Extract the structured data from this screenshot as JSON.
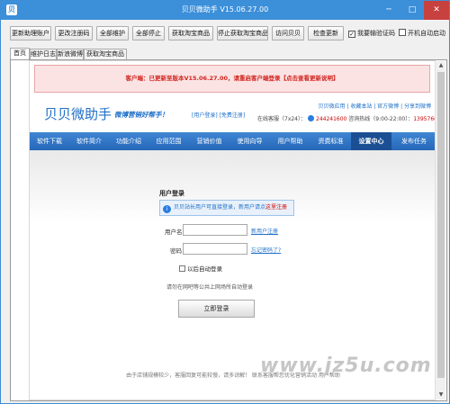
{
  "window": {
    "title": "贝贝微助手 V15.06.27.00",
    "minimize": "─",
    "maximize": "□",
    "close": "✕"
  },
  "toolbar": {
    "buttons": [
      "更新助理账户",
      "更改注册码",
      "全部维护",
      "全部停止",
      "获取淘宝商品",
      "停止获取淘宝商品",
      "访问贝贝",
      "检查更新"
    ],
    "checkboxes": [
      {
        "label": "我要输验证码",
        "checked": true
      },
      {
        "label": "开机自动启动",
        "checked": false
      }
    ]
  },
  "tabs": [
    "首页",
    "维护日志",
    "新浪微博",
    "获取淘宝商品"
  ],
  "notice": "客户端：已更新至版本V15.06.27.00，请重启客户端登录【点击查看更新说明】",
  "site": {
    "logo": "贝贝微助手",
    "slogan": "微博营销好帮手！",
    "header_links": "[用户登录] [免费注册]",
    "top_links": "贝贝微应用 | 收藏本站 | 官方微博 | 分享到微博",
    "online_label": "在线客服（7x24）：",
    "qq": "244241600",
    "hours_label": "咨询热线（9:00-22:00）：",
    "phone": "13957666096",
    "nav": [
      "软件下载",
      "软件简介",
      "功能介绍",
      "应用范围",
      "营销价值",
      "使用向导",
      "用户帮助",
      "资费标准",
      "设置中心",
      "发布任务"
    ],
    "nav_active_index": 8
  },
  "login": {
    "title": "用户登录",
    "info_text": "贝贝站长用户可直接登录，新用户请点",
    "info_link": "这里注册",
    "username_label": "用户名：",
    "username_value": "",
    "register_link": "新用户注册",
    "password_label": "密码：",
    "password_value": "",
    "forgot_link": "忘记密码了?",
    "remember_label": "以后自动登录",
    "hint": "请勿在网吧等公共上网场所自动登录",
    "button": "立即登录"
  },
  "footer": "由于店铺规模较少，客服回复可能较慢，请多谅解！ 联系客服帮您优化营销活动 用户帮助",
  "watermark": "www.jz5u.com",
  "colors": {
    "titlebar": "#3c8fd9",
    "nav": "#2f76c8",
    "notice_text": "#d0241f",
    "link": "#1e6fc8",
    "close_button": "#c7413f"
  }
}
